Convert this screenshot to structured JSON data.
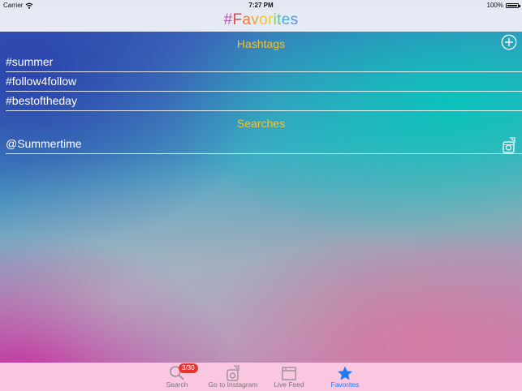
{
  "status_bar": {
    "carrier": "Carrier",
    "time": "7:27 PM",
    "battery": "100%"
  },
  "nav": {
    "title_letters": [
      {
        "char": "#",
        "color": "#d13fb0"
      },
      {
        "char": "F",
        "color": "#e5464a"
      },
      {
        "char": "a",
        "color": "#ef7b3a"
      },
      {
        "char": "v",
        "color": "#f0a63b"
      },
      {
        "char": "o",
        "color": "#f2c230"
      },
      {
        "char": "r",
        "color": "#e7d234"
      },
      {
        "char": "i",
        "color": "#8dcf5a"
      },
      {
        "char": "t",
        "color": "#55c6a0"
      },
      {
        "char": "e",
        "color": "#4aaed8"
      },
      {
        "char": "s",
        "color": "#5c8ee0"
      }
    ]
  },
  "hashtags": {
    "header": "Hashtags",
    "items": [
      "#summer",
      "#follow4follow",
      "#bestoftheday"
    ]
  },
  "searches": {
    "header": "Searches",
    "items": [
      "@Summertime"
    ]
  },
  "tabs": [
    {
      "label": "Search",
      "icon": "magnifier-icon",
      "badge": "3/30",
      "active": false
    },
    {
      "label": "Go to Instagram",
      "icon": "instagram-icon",
      "active": false
    },
    {
      "label": "Live Feed",
      "icon": "feed-icon",
      "active": false
    },
    {
      "label": "Favorites",
      "icon": "star-icon",
      "active": true
    }
  ],
  "colors": {
    "accent": "#1f7cf0",
    "section_header": "#f1c232",
    "badge": "#e8342f",
    "tab_bar": "#fbc7e0"
  }
}
